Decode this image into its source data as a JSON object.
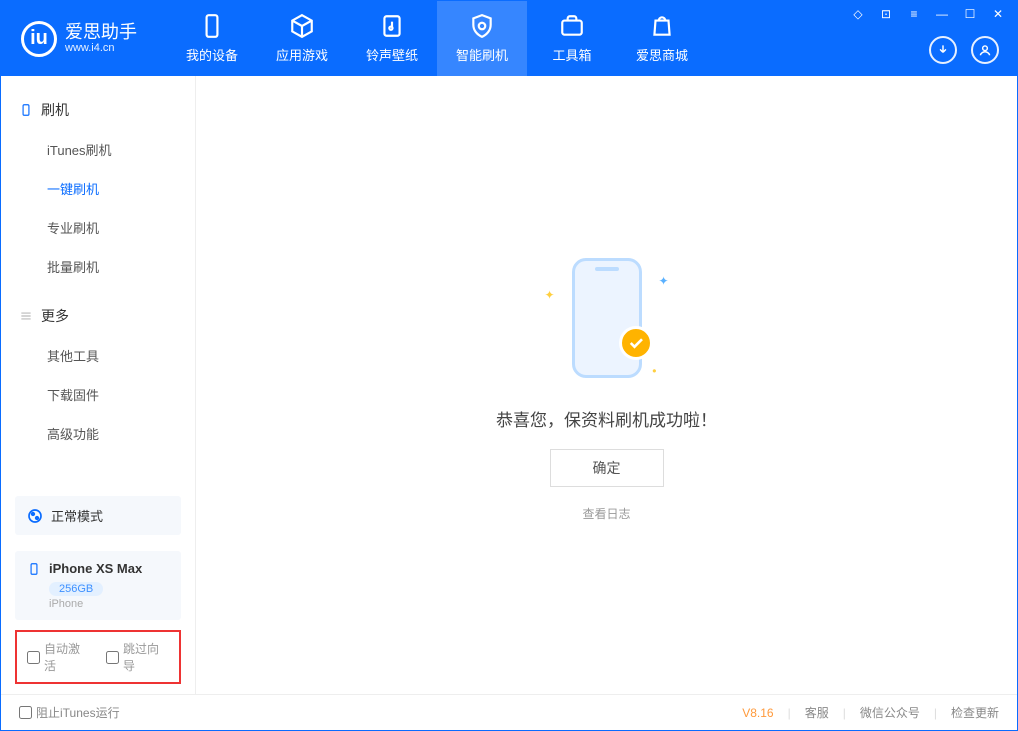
{
  "app": {
    "name": "爱思助手",
    "domain": "www.i4.cn"
  },
  "tabs": {
    "device": "我的设备",
    "apps": "应用游戏",
    "ring": "铃声壁纸",
    "flash": "智能刷机",
    "tools": "工具箱",
    "store": "爱思商城"
  },
  "sidebar": {
    "group1_title": "刷机",
    "items1": {
      "itunes": "iTunes刷机",
      "oneclick": "一键刷机",
      "pro": "专业刷机",
      "batch": "批量刷机"
    },
    "group2_title": "更多",
    "items2": {
      "othertools": "其他工具",
      "firmware": "下载固件",
      "advanced": "高级功能"
    }
  },
  "mode": {
    "label": "正常模式"
  },
  "device": {
    "name": "iPhone XS Max",
    "storage": "256GB",
    "type": "iPhone"
  },
  "checks": {
    "auto_activate": "自动激活",
    "skip_guide": "跳过向导"
  },
  "main": {
    "message": "恭喜您，保资料刷机成功啦！",
    "ok": "确定",
    "view_log": "查看日志"
  },
  "footer": {
    "block_itunes": "阻止iTunes运行",
    "version": "V8.16",
    "service": "客服",
    "wechat": "微信公众号",
    "update": "检查更新"
  }
}
